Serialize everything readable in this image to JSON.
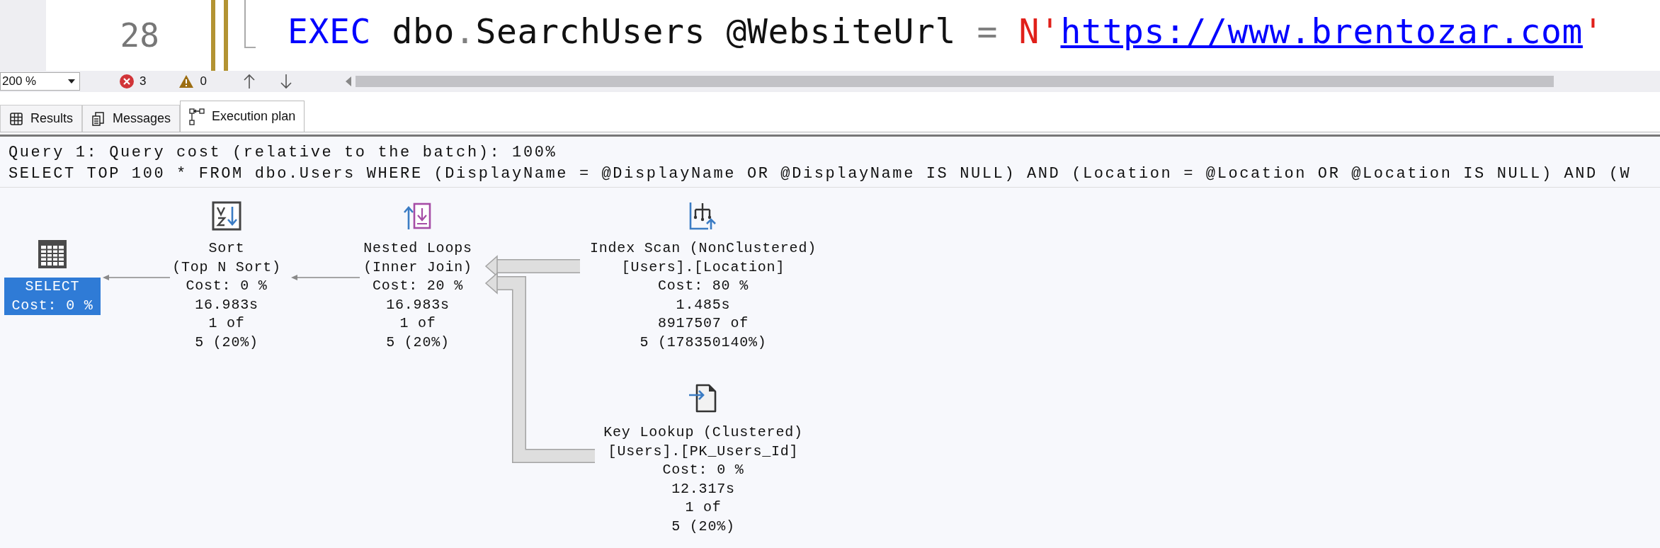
{
  "editor": {
    "line_number": "28",
    "code": [
      {
        "kind": "keyword",
        "text": "EXEC"
      },
      {
        "kind": "plain",
        "text": " dbo"
      },
      {
        "kind": "operator",
        "text": "."
      },
      {
        "kind": "plain",
        "text": "SearchUsers @WebsiteUrl "
      },
      {
        "kind": "operator",
        "text": "="
      },
      {
        "kind": "string",
        "text": " N'"
      },
      {
        "kind": "link",
        "text": "https://www.brentozar.com"
      },
      {
        "kind": "string",
        "text": "'"
      }
    ]
  },
  "toolbar": {
    "zoom": "200 %",
    "errors": "3",
    "warnings": "0"
  },
  "tabs": [
    {
      "label": "Results",
      "selected": false
    },
    {
      "label": "Messages",
      "selected": false
    },
    {
      "label": "Execution plan",
      "selected": true
    }
  ],
  "query_header": [
    "Query 1: Query cost (relative to the batch): 100%",
    "SELECT TOP 100 * FROM dbo.Users WHERE (DisplayName = @DisplayName OR @DisplayName IS NULL) AND (Location = @Location OR @Location IS NULL) AND (W"
  ],
  "plan": {
    "nodes": [
      {
        "kind": "select",
        "selected": true,
        "lines": [
          "SELECT",
          "Cost: 0 %"
        ]
      },
      {
        "kind": "sort",
        "selected": false,
        "thick_arrow": false,
        "lines": [
          "Sort",
          "(Top N Sort)",
          "Cost: 0 %",
          "16.983s",
          "1 of",
          "5 (20%)"
        ]
      },
      {
        "kind": "nested_loops",
        "selected": false,
        "thick_arrow": false,
        "lines": [
          "Nested Loops",
          "(Inner Join)",
          "Cost: 20 %",
          "16.983s",
          "1 of",
          "5 (20%)"
        ]
      },
      {
        "kind": "index_scan",
        "selected": false,
        "thick_arrow": true,
        "lines": [
          "Index Scan (NonClustered)",
          "[Users].[Location]",
          "Cost: 80 %",
          "1.485s",
          "8917507 of",
          "5 (178350140%)"
        ]
      },
      {
        "kind": "key_lookup",
        "selected": false,
        "thick_arrow": true,
        "lines": [
          "Key Lookup (Clustered)",
          "[Users].[PK_Users_Id]",
          "Cost: 0 %",
          "12.317s",
          "1 of",
          "5 (20%)"
        ]
      }
    ]
  }
}
